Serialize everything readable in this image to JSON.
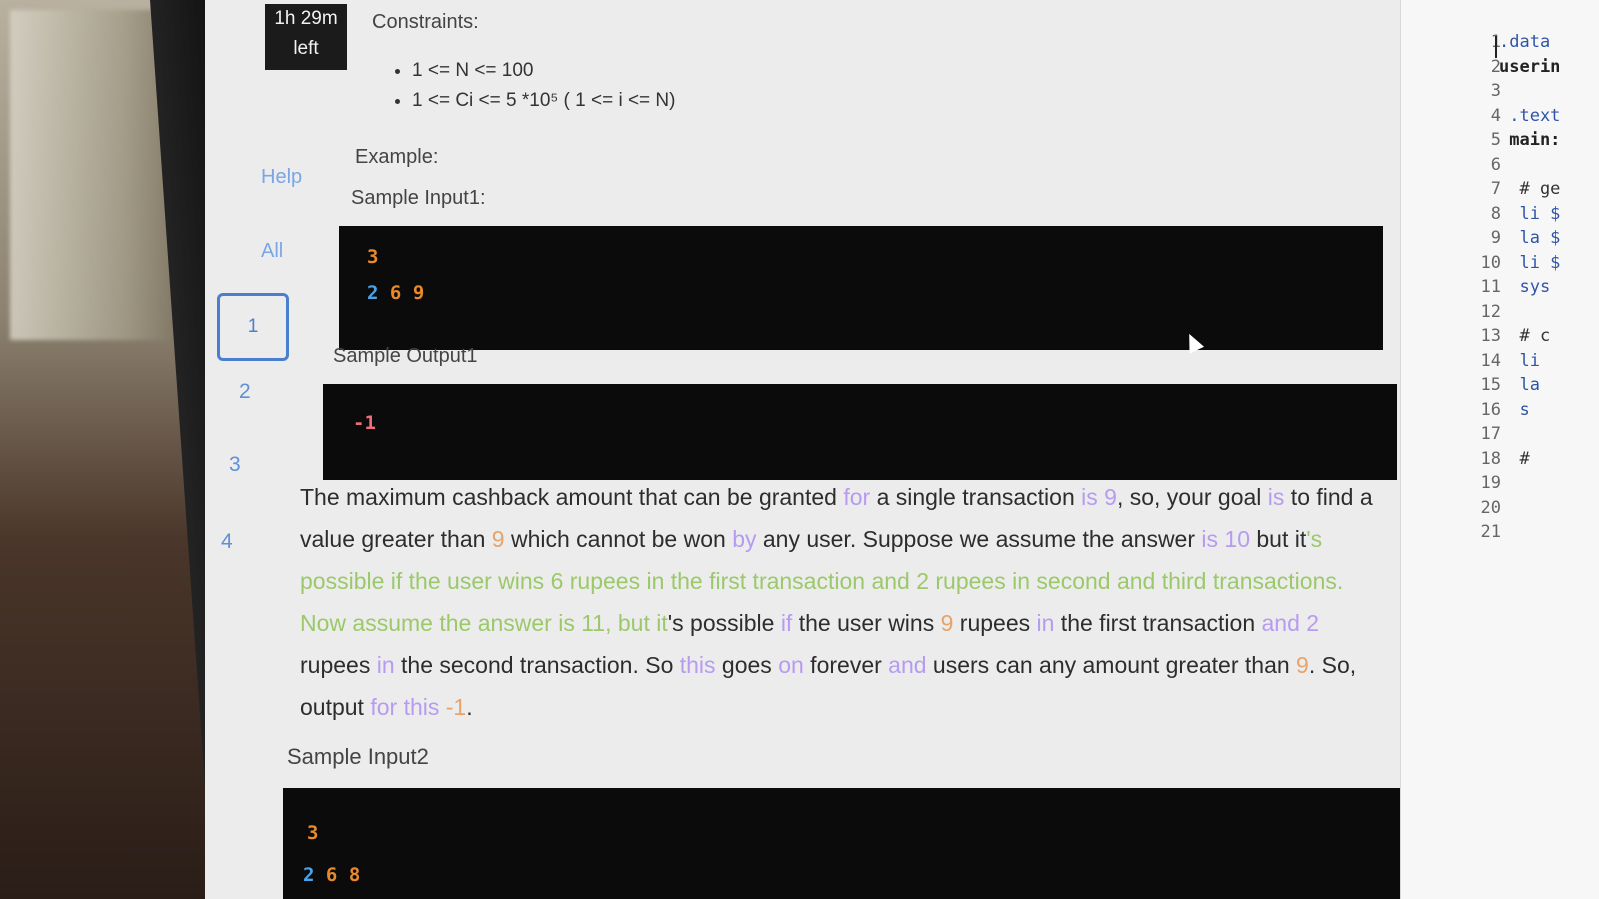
{
  "timer": {
    "line1": "1h 29m",
    "line2": "left"
  },
  "nav": {
    "help": "Help",
    "all": "All",
    "questions": [
      "1",
      "2",
      "3",
      "4"
    ]
  },
  "problem": {
    "constraints_heading": "Constraints:",
    "constraints": [
      "1 <= N <= 100",
      "1 <= Ci <= 5 *10⁵ ( 1 <= i <= N)"
    ],
    "example_heading": "Example:",
    "sample_input1_label": "Sample Input1:",
    "sample_input1": {
      "line1": "3",
      "line2": [
        "2",
        "6",
        "9"
      ]
    },
    "sample_output1_label": "Sample Output1",
    "sample_output1": "-1",
    "explanation": [
      {
        "t": "The maximum cashback amount that can be granted ",
        "c": ""
      },
      {
        "t": "for",
        "c": "c1"
      },
      {
        "t": " a single transaction ",
        "c": ""
      },
      {
        "t": "is 9",
        "c": "c1"
      },
      {
        "t": ", so, your goal ",
        "c": ""
      },
      {
        "t": "is",
        "c": "c1"
      },
      {
        "t": " to find a value greater than ",
        "c": ""
      },
      {
        "t": "9",
        "c": "c3"
      },
      {
        "t": " which cannot be won ",
        "c": ""
      },
      {
        "t": "by",
        "c": "c1"
      },
      {
        "t": " any user. Suppose we assume the answer ",
        "c": ""
      },
      {
        "t": "is 10",
        "c": "c1"
      },
      {
        "t": " but it",
        "c": ""
      },
      {
        "t": "'s possible if the user wins 6 rupees in the first transaction and 2 rupees in second and third transactions. Now assume the answer is 11, but it",
        "c": "c2"
      },
      {
        "t": "'s possible ",
        "c": ""
      },
      {
        "t": "if",
        "c": "c1"
      },
      {
        "t": " the user wins ",
        "c": ""
      },
      {
        "t": "9",
        "c": "c3"
      },
      {
        "t": " rupees ",
        "c": ""
      },
      {
        "t": "in",
        "c": "c1"
      },
      {
        "t": " the first transaction ",
        "c": ""
      },
      {
        "t": "and 2",
        "c": "c1"
      },
      {
        "t": " rupees ",
        "c": ""
      },
      {
        "t": "in",
        "c": "c1"
      },
      {
        "t": " the second transaction. So ",
        "c": ""
      },
      {
        "t": "this",
        "c": "c1"
      },
      {
        "t": " goes ",
        "c": ""
      },
      {
        "t": "on",
        "c": "c1"
      },
      {
        "t": " forever ",
        "c": ""
      },
      {
        "t": "and",
        "c": "c1"
      },
      {
        "t": " users can any amount greater than ",
        "c": ""
      },
      {
        "t": "9",
        "c": "c3"
      },
      {
        "t": ". So, output ",
        "c": ""
      },
      {
        "t": "for this",
        "c": "c1"
      },
      {
        "t": " -1",
        "c": "c3"
      },
      {
        "t": ".",
        "c": ""
      }
    ],
    "sample_input2_label": "Sample Input2",
    "sample_input2": {
      "line1": "3",
      "line2": [
        "2",
        "6",
        "8"
      ]
    }
  },
  "editor": {
    "line_numbers": [
      "1",
      "2",
      "3",
      "4",
      "5",
      "6",
      "7",
      "8",
      "9",
      "10",
      "11",
      "12",
      "13",
      "14",
      "15",
      "16",
      "17",
      "18",
      "19",
      "20",
      "21"
    ],
    "lines": [
      {
        "t": ".data",
        "c": "kw"
      },
      {
        "t": "userin",
        "c": "lab"
      },
      {
        "t": "",
        "c": ""
      },
      {
        "t": " .text",
        "c": "kw"
      },
      {
        "t": " main:",
        "c": "lab"
      },
      {
        "t": "",
        "c": ""
      },
      {
        "t": "  # ge",
        "c": "cm"
      },
      {
        "t": "  li $",
        "c": "kw"
      },
      {
        "t": "  la $",
        "c": "kw"
      },
      {
        "t": "  li $",
        "c": "kw"
      },
      {
        "t": "  sys",
        "c": "kw"
      },
      {
        "t": "",
        "c": ""
      },
      {
        "t": "  # c",
        "c": "cm"
      },
      {
        "t": "  li",
        "c": "kw"
      },
      {
        "t": "  la",
        "c": "kw"
      },
      {
        "t": "  s",
        "c": "kw"
      },
      {
        "t": "",
        "c": ""
      },
      {
        "t": "  #",
        "c": "cm"
      },
      {
        "t": "",
        "c": ""
      },
      {
        "t": "",
        "c": ""
      },
      {
        "t": "",
        "c": ""
      }
    ]
  }
}
